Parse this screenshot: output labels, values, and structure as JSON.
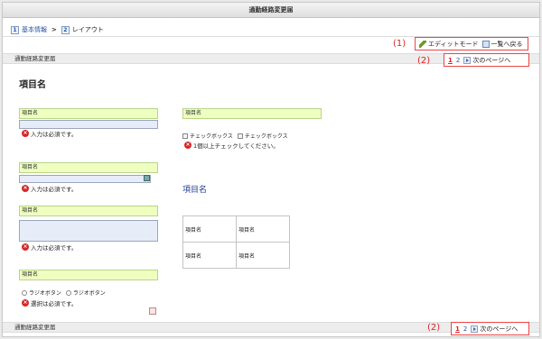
{
  "window": {
    "title": "通勤経路変更届"
  },
  "breadcrumb": {
    "steps": [
      {
        "num": "1",
        "label": "基本情報"
      },
      {
        "num": "2",
        "label": "レイアウト"
      }
    ],
    "separator": ">"
  },
  "annotations": {
    "a1": "(1)",
    "a2": "(2)",
    "a3": "(2)"
  },
  "toolbar": {
    "edit_mode": "エディットモード",
    "back_to_list": "一覧へ戻る"
  },
  "pager": {
    "page1": "1",
    "page2": "2",
    "next": "次のページへ"
  },
  "section": {
    "top_title": "通勤経路変更届",
    "bottom_title": "通勤経路変更届"
  },
  "form": {
    "heading": "項目名",
    "field_label": "項目名",
    "required_error": "入力は必須です。",
    "select_error": "選択は必須です。",
    "checkbox_error": "1個以上チェックしてください。",
    "checkbox_1": "チェックボックス",
    "checkbox_2": "チェックボックス",
    "radio_1": "ラジオボタン",
    "radio_2": "ラジオボタン",
    "right_heading": "項目名",
    "table_cells": [
      [
        "項目名",
        "項目名"
      ],
      [
        "項目名",
        "項目名"
      ]
    ]
  }
}
